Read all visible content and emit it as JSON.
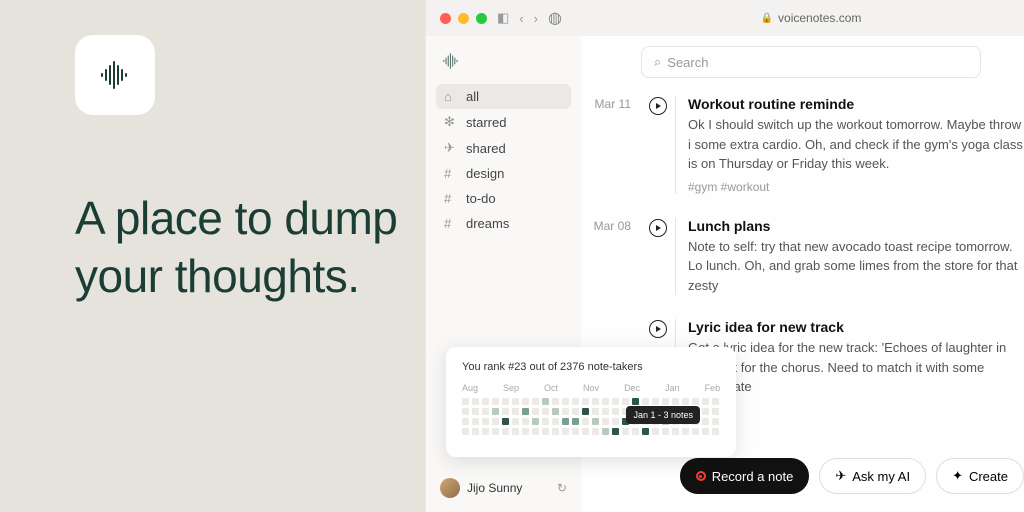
{
  "hero": {
    "tagline": "A place to dump your thoughts."
  },
  "toolbar": {
    "url": "voicenotes.com"
  },
  "sidebar": {
    "items": [
      {
        "icon": "⌂",
        "label": "all",
        "active": true
      },
      {
        "icon": "✻",
        "label": "starred"
      },
      {
        "icon": "✈",
        "label": "shared"
      },
      {
        "icon": "#",
        "label": "design"
      },
      {
        "icon": "#",
        "label": "to-do"
      },
      {
        "icon": "#",
        "label": "dreams"
      }
    ],
    "user": "Jijo Sunny"
  },
  "heatmap": {
    "title": "You rank #23 out of 2376 note-takers",
    "months": [
      "Aug",
      "Sep",
      "Oct",
      "Nov",
      "Dec",
      "Jan",
      "Feb"
    ],
    "tooltip": "Jan 1 - 3 notes"
  },
  "search": {
    "placeholder": "Search"
  },
  "notes": [
    {
      "date": "Mar 11",
      "title": "Workout routine reminde",
      "text": "Ok I should switch up the workout tomorrow. Maybe throw i some extra cardio. Oh, and check if the gym's yoga class is on Thursday or Friday this week.",
      "tags": "#gym  #workout"
    },
    {
      "date": "Mar 08",
      "title": "Lunch plans",
      "text": "Note to self: try that new avocado toast recipe tomorrow. Lo lunch. Oh, and grab some limes from the store for that zesty"
    },
    {
      "date": "",
      "title": "Lyric idea for new track",
      "text": "Got a lyric idea for the new track: 'Echoes of laughter in the work for the chorus. Need to match it with some chords late"
    }
  ],
  "actions": {
    "record": "Record a note",
    "ask": "Ask my AI",
    "create": "Create"
  }
}
